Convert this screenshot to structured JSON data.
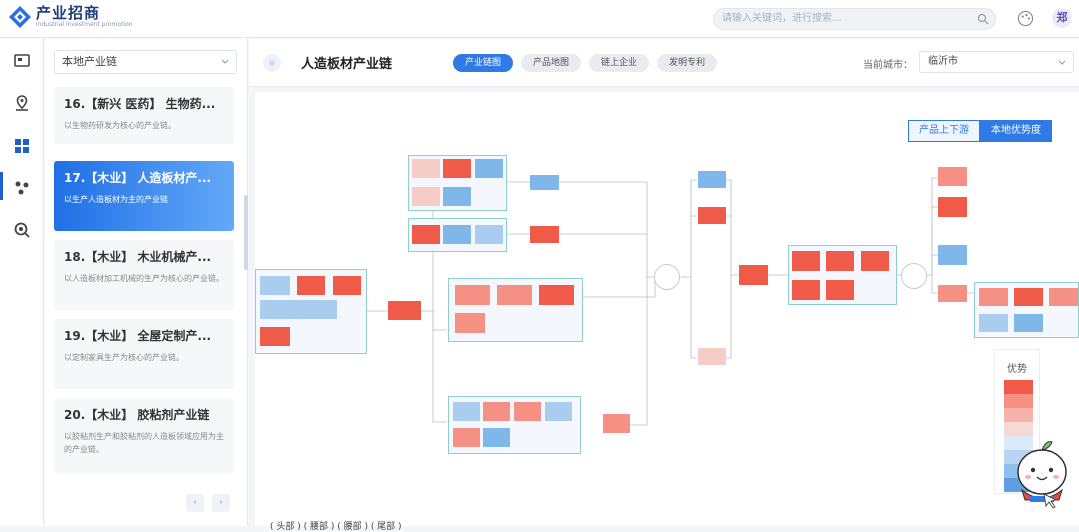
{
  "app": {
    "name": "产业招商",
    "subtitle": "industrial investment promotion"
  },
  "search": {
    "placeholder": "请输入关键词，进行搜索..."
  },
  "user": {
    "avatar_text": "郑"
  },
  "sidebar": {
    "select_value": "本地产业链"
  },
  "chain_list": [
    {
      "title": "16.【新兴 医药】 生物药...",
      "desc": "以生物药研发为核心的产业链。"
    },
    {
      "title": "17.【木业】 人造板材产...",
      "desc": "以生产人造板材为主的产业链"
    },
    {
      "title": "18.【木业】 木业机械产...",
      "desc": "以人造板材加工机械的生产为核心的产业链。"
    },
    {
      "title": "19.【木业】 全屋定制产...",
      "desc": "以定制家具生产为核心的产业链。"
    },
    {
      "title": "20.【木业】 胶粘剂产业链",
      "desc": "以胶粘剂生产和胶粘剂的人造板领域应用为主的产业链。"
    }
  ],
  "main": {
    "title": "人造板材产业链",
    "tabs": [
      "产业链图",
      "产品地图",
      "链上企业",
      "发明专利"
    ],
    "city_label": "当前城市：",
    "city_value": "临沂市"
  },
  "view_toggle": [
    "产品上下游",
    "本地优势度"
  ],
  "legend": {
    "title": "优势",
    "colors": [
      "#f05a48",
      "#f49184",
      "#f6b3aa",
      "#f6d9d4",
      "#dbe9f8",
      "#b7d4f2",
      "#8ec0ec",
      "#5f9fdf"
    ]
  },
  "pager": {
    "prev": "‹",
    "next": "›"
  },
  "bottom_text": "( 头部 ) ( 腰部 ) ( 腰部 ) ( 尾部 )"
}
